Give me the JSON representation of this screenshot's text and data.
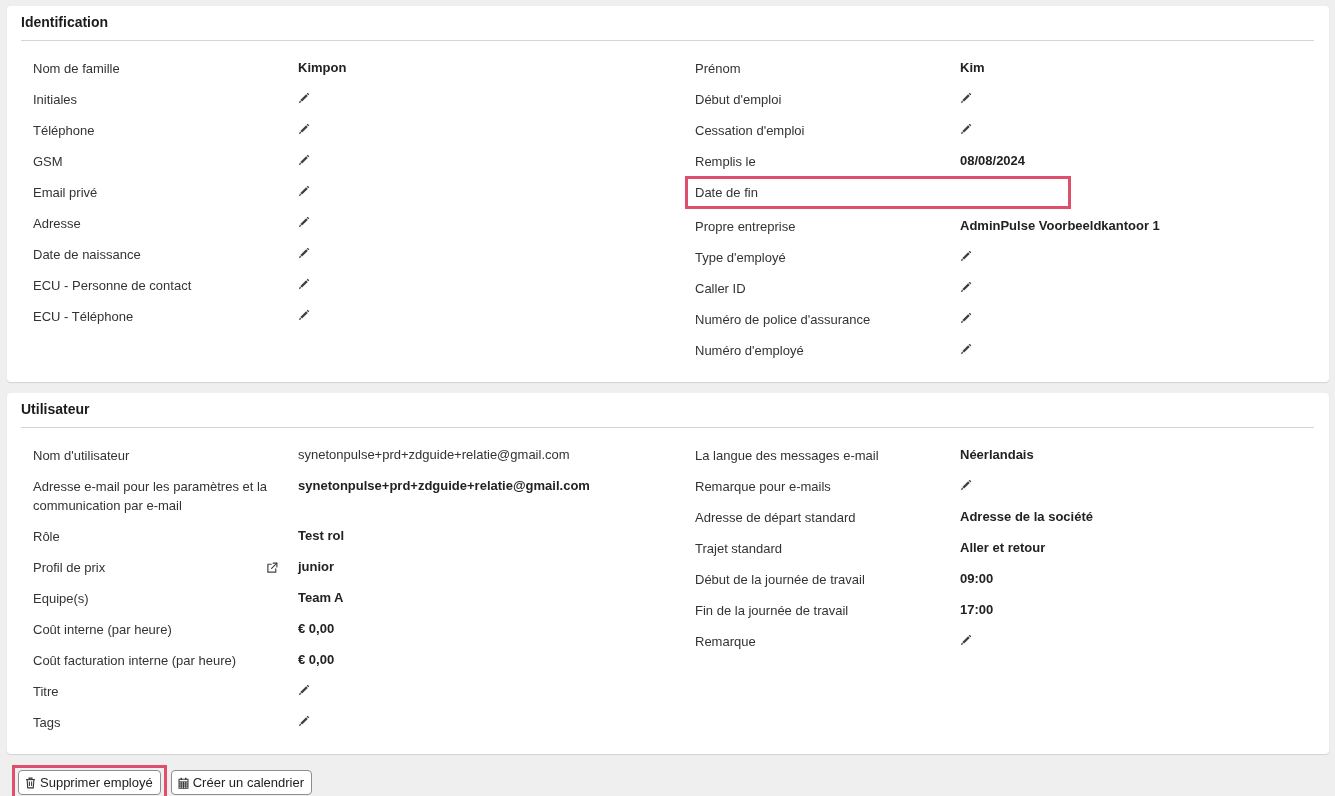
{
  "sections": [
    {
      "title": "Identification",
      "columns": [
        [
          {
            "label": "Nom de famille",
            "kind": "value",
            "value": "Kimpon",
            "highlighted": false
          },
          {
            "label": "Initiales",
            "kind": "edit",
            "highlighted": false
          },
          {
            "label": "Téléphone",
            "kind": "edit",
            "highlighted": false
          },
          {
            "label": "GSM",
            "kind": "edit",
            "highlighted": false
          },
          {
            "label": "Email privé",
            "kind": "edit",
            "highlighted": false
          },
          {
            "label": "Adresse",
            "kind": "edit",
            "highlighted": false
          },
          {
            "label": "Date de naissance",
            "kind": "edit",
            "highlighted": false
          },
          {
            "label": "ECU - Personne de contact",
            "kind": "edit",
            "highlighted": false
          },
          {
            "label": "ECU - Téléphone",
            "kind": "edit",
            "highlighted": false
          }
        ],
        [
          {
            "label": "Prénom",
            "kind": "value",
            "value": "Kim",
            "highlighted": false
          },
          {
            "label": "Début d'emploi",
            "kind": "edit",
            "highlighted": false
          },
          {
            "label": "Cessation d'emploi",
            "kind": "edit",
            "highlighted": false
          },
          {
            "label": "Remplis le",
            "kind": "value",
            "value": "08/08/2024",
            "highlighted": false
          },
          {
            "label": "Date de fin",
            "kind": "empty",
            "highlighted": true
          },
          {
            "label": "Propre entreprise",
            "kind": "value",
            "value": "AdminPulse Voorbeeldkantoor 1",
            "highlighted": false
          },
          {
            "label": "Type d'employé",
            "kind": "edit",
            "highlighted": false
          },
          {
            "label": "Caller ID",
            "kind": "edit",
            "highlighted": false
          },
          {
            "label": "Numéro de police d'assurance",
            "kind": "edit",
            "highlighted": false
          },
          {
            "label": "Numéro d'employé",
            "kind": "edit",
            "highlighted": false
          }
        ]
      ]
    },
    {
      "title": "Utilisateur",
      "columns": [
        [
          {
            "label": "Nom d'utilisateur",
            "kind": "plain",
            "value": "synetonpulse+prd+zdguide+relatie@gmail.com",
            "highlighted": false
          },
          {
            "label": "Adresse e-mail pour les paramètres et la communication par e-mail",
            "kind": "value",
            "value": "synetonpulse+prd+zdguide+relatie@gmail.com",
            "highlighted": false
          },
          {
            "label": "Rôle",
            "kind": "value",
            "value": "Test rol",
            "highlighted": false
          },
          {
            "label": "Profil de prix",
            "kind": "linked",
            "value": "junior",
            "highlighted": false
          },
          {
            "label": "Equipe(s)",
            "kind": "value",
            "value": "Team A",
            "highlighted": false
          },
          {
            "label": "Coût interne (par heure)",
            "kind": "value",
            "value": "€ 0,00",
            "highlighted": false
          },
          {
            "label": "Coût facturation interne (par heure)",
            "kind": "value",
            "value": "€ 0,00",
            "highlighted": false
          },
          {
            "label": "Titre",
            "kind": "edit",
            "highlighted": false
          },
          {
            "label": "Tags",
            "kind": "edit",
            "highlighted": false
          }
        ],
        [
          {
            "label": "La langue des messages e-mail",
            "kind": "value",
            "value": "Néerlandais",
            "highlighted": false
          },
          {
            "label": "Remarque pour e-mails",
            "kind": "edit",
            "highlighted": false
          },
          {
            "label": "Adresse de départ standard",
            "kind": "value",
            "value": "Adresse de la société",
            "highlighted": false
          },
          {
            "label": "Trajet standard",
            "kind": "value",
            "value": "Aller et retour",
            "highlighted": false
          },
          {
            "label": "Début de la journée de travail",
            "kind": "value",
            "value": "09:00",
            "highlighted": false
          },
          {
            "label": "Fin de la journée de travail",
            "kind": "value",
            "value": "17:00",
            "highlighted": false
          },
          {
            "label": "Remarque",
            "kind": "edit",
            "highlighted": false
          }
        ]
      ]
    }
  ],
  "buttons": [
    {
      "label": "Supprimer employé",
      "kind": "delete",
      "highlighted": true
    },
    {
      "label": "Créer un calendrier",
      "kind": "calendar",
      "highlighted": false
    }
  ]
}
